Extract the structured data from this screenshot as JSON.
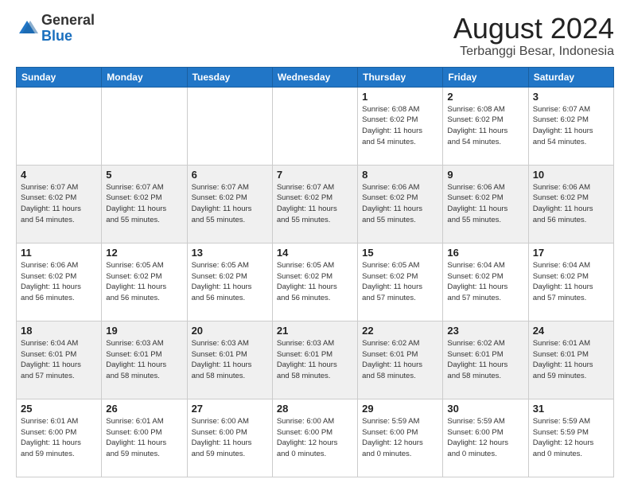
{
  "logo": {
    "general": "General",
    "blue": "Blue"
  },
  "header": {
    "month_title": "August 2024",
    "location": "Terbanggi Besar, Indonesia"
  },
  "weekdays": [
    "Sunday",
    "Monday",
    "Tuesday",
    "Wednesday",
    "Thursday",
    "Friday",
    "Saturday"
  ],
  "rows": [
    [
      {
        "day": "",
        "info": ""
      },
      {
        "day": "",
        "info": ""
      },
      {
        "day": "",
        "info": ""
      },
      {
        "day": "",
        "info": ""
      },
      {
        "day": "1",
        "info": "Sunrise: 6:08 AM\nSunset: 6:02 PM\nDaylight: 11 hours\nand 54 minutes."
      },
      {
        "day": "2",
        "info": "Sunrise: 6:08 AM\nSunset: 6:02 PM\nDaylight: 11 hours\nand 54 minutes."
      },
      {
        "day": "3",
        "info": "Sunrise: 6:07 AM\nSunset: 6:02 PM\nDaylight: 11 hours\nand 54 minutes."
      }
    ],
    [
      {
        "day": "4",
        "info": "Sunrise: 6:07 AM\nSunset: 6:02 PM\nDaylight: 11 hours\nand 54 minutes."
      },
      {
        "day": "5",
        "info": "Sunrise: 6:07 AM\nSunset: 6:02 PM\nDaylight: 11 hours\nand 55 minutes."
      },
      {
        "day": "6",
        "info": "Sunrise: 6:07 AM\nSunset: 6:02 PM\nDaylight: 11 hours\nand 55 minutes."
      },
      {
        "day": "7",
        "info": "Sunrise: 6:07 AM\nSunset: 6:02 PM\nDaylight: 11 hours\nand 55 minutes."
      },
      {
        "day": "8",
        "info": "Sunrise: 6:06 AM\nSunset: 6:02 PM\nDaylight: 11 hours\nand 55 minutes."
      },
      {
        "day": "9",
        "info": "Sunrise: 6:06 AM\nSunset: 6:02 PM\nDaylight: 11 hours\nand 55 minutes."
      },
      {
        "day": "10",
        "info": "Sunrise: 6:06 AM\nSunset: 6:02 PM\nDaylight: 11 hours\nand 56 minutes."
      }
    ],
    [
      {
        "day": "11",
        "info": "Sunrise: 6:06 AM\nSunset: 6:02 PM\nDaylight: 11 hours\nand 56 minutes."
      },
      {
        "day": "12",
        "info": "Sunrise: 6:05 AM\nSunset: 6:02 PM\nDaylight: 11 hours\nand 56 minutes."
      },
      {
        "day": "13",
        "info": "Sunrise: 6:05 AM\nSunset: 6:02 PM\nDaylight: 11 hours\nand 56 minutes."
      },
      {
        "day": "14",
        "info": "Sunrise: 6:05 AM\nSunset: 6:02 PM\nDaylight: 11 hours\nand 56 minutes."
      },
      {
        "day": "15",
        "info": "Sunrise: 6:05 AM\nSunset: 6:02 PM\nDaylight: 11 hours\nand 57 minutes."
      },
      {
        "day": "16",
        "info": "Sunrise: 6:04 AM\nSunset: 6:02 PM\nDaylight: 11 hours\nand 57 minutes."
      },
      {
        "day": "17",
        "info": "Sunrise: 6:04 AM\nSunset: 6:02 PM\nDaylight: 11 hours\nand 57 minutes."
      }
    ],
    [
      {
        "day": "18",
        "info": "Sunrise: 6:04 AM\nSunset: 6:01 PM\nDaylight: 11 hours\nand 57 minutes."
      },
      {
        "day": "19",
        "info": "Sunrise: 6:03 AM\nSunset: 6:01 PM\nDaylight: 11 hours\nand 58 minutes."
      },
      {
        "day": "20",
        "info": "Sunrise: 6:03 AM\nSunset: 6:01 PM\nDaylight: 11 hours\nand 58 minutes."
      },
      {
        "day": "21",
        "info": "Sunrise: 6:03 AM\nSunset: 6:01 PM\nDaylight: 11 hours\nand 58 minutes."
      },
      {
        "day": "22",
        "info": "Sunrise: 6:02 AM\nSunset: 6:01 PM\nDaylight: 11 hours\nand 58 minutes."
      },
      {
        "day": "23",
        "info": "Sunrise: 6:02 AM\nSunset: 6:01 PM\nDaylight: 11 hours\nand 58 minutes."
      },
      {
        "day": "24",
        "info": "Sunrise: 6:01 AM\nSunset: 6:01 PM\nDaylight: 11 hours\nand 59 minutes."
      }
    ],
    [
      {
        "day": "25",
        "info": "Sunrise: 6:01 AM\nSunset: 6:00 PM\nDaylight: 11 hours\nand 59 minutes."
      },
      {
        "day": "26",
        "info": "Sunrise: 6:01 AM\nSunset: 6:00 PM\nDaylight: 11 hours\nand 59 minutes."
      },
      {
        "day": "27",
        "info": "Sunrise: 6:00 AM\nSunset: 6:00 PM\nDaylight: 11 hours\nand 59 minutes."
      },
      {
        "day": "28",
        "info": "Sunrise: 6:00 AM\nSunset: 6:00 PM\nDaylight: 12 hours\nand 0 minutes."
      },
      {
        "day": "29",
        "info": "Sunrise: 5:59 AM\nSunset: 6:00 PM\nDaylight: 12 hours\nand 0 minutes."
      },
      {
        "day": "30",
        "info": "Sunrise: 5:59 AM\nSunset: 6:00 PM\nDaylight: 12 hours\nand 0 minutes."
      },
      {
        "day": "31",
        "info": "Sunrise: 5:59 AM\nSunset: 5:59 PM\nDaylight: 12 hours\nand 0 minutes."
      }
    ]
  ]
}
